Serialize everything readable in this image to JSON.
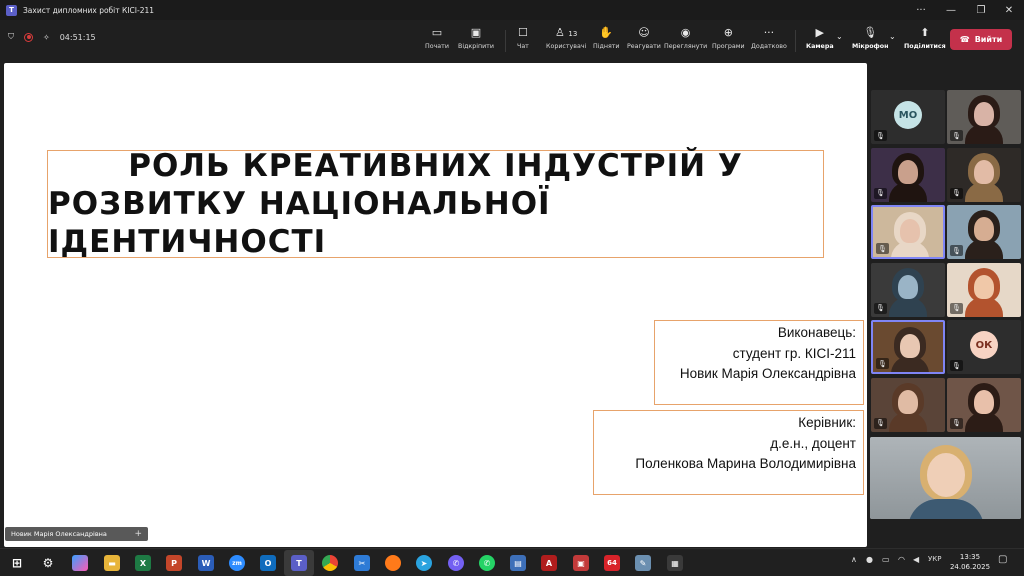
{
  "window": {
    "title": "Захист дипломних робіт КІСІ-211"
  },
  "toolbar": {
    "timer": "04:51:15",
    "buttons": [
      {
        "label": "Почати",
        "icon": "share-screen-icon"
      },
      {
        "label": "Відкріпити",
        "icon": "unpin-icon"
      },
      {
        "label": "Чат",
        "icon": "chat-icon"
      },
      {
        "label": "Користувачі",
        "icon": "people-icon",
        "count": "13"
      },
      {
        "label": "Підняти",
        "icon": "raise-hand-icon"
      },
      {
        "label": "Реагувати",
        "icon": "react-icon"
      },
      {
        "label": "Переглянути",
        "icon": "view-icon"
      },
      {
        "label": "Програми",
        "icon": "apps-icon"
      },
      {
        "label": "Додатково",
        "icon": "more-icon"
      },
      {
        "label": "Камера",
        "icon": "camera-icon"
      },
      {
        "label": "Мікрофон",
        "icon": "mic-icon"
      },
      {
        "label": "Поділитися",
        "icon": "share-icon"
      }
    ],
    "leave_label": "Вийти"
  },
  "slide": {
    "title_line1": "РОЛЬ КРЕАТИВНИХ ІНДУСТРІЙ У",
    "title_line2": "РОЗВИТКУ НАЦІОНАЛЬНОЇ ІДЕНТИЧНОСТІ",
    "author": {
      "line1": "Виконавець:",
      "line2": "студент гр. КІСІ-211",
      "line3": "Новик Марія Олександрівна"
    },
    "supervisor": {
      "line1": "Керівник:",
      "line2": "д.е.н., доцент",
      "line3": "Поленкова Марина Володимирівна"
    }
  },
  "presenter_tag": "Новик Марія Олександрівна",
  "participants": [
    {
      "initials": "МО",
      "color": "#c5e3e6",
      "text_color": "#2a5560"
    },
    {
      "initials": "",
      "skin": "#d8b3a6",
      "hair": "#2a1b16",
      "bg": "#5f5c58"
    },
    {
      "initials": "",
      "skin": "#c9a08c",
      "hair": "#1f1410",
      "bg": "#3d2f48"
    },
    {
      "initials": "",
      "skin": "#e2bba6",
      "hair": "#8a6a45",
      "bg": "#2e2a27"
    },
    {
      "initials": "",
      "skin": "#e6c2ad",
      "hair": "#e8d7c6",
      "bg": "#cdb89c"
    },
    {
      "initials": "",
      "skin": "#d6ad92",
      "hair": "#2a201b",
      "bg": "#8aa2b2"
    },
    {
      "initials": "",
      "skin": "#9ab4c6",
      "hair": "#2f4250",
      "bg": "#3a3a3a"
    },
    {
      "initials": "",
      "skin": "#f0c8a8",
      "hair": "#b3532e",
      "bg": "#e6d8c8"
    },
    {
      "initials": "",
      "skin": "#e8c7b2",
      "hair": "#3b2a21",
      "bg": "#6a4a30"
    },
    {
      "initials": "ОК",
      "color": "#f7d3c3",
      "text_color": "#7a2f20"
    },
    {
      "initials": "",
      "skin": "#e0bba4",
      "hair": "#5a3a28",
      "bg": "#5a4438"
    },
    {
      "initials": "",
      "skin": "#e8c0aa",
      "hair": "#2c1c16",
      "bg": "#6f5548"
    }
  ],
  "taskbar": {
    "lang": "УКР",
    "time": "13:35",
    "date": "24.06.2025"
  }
}
